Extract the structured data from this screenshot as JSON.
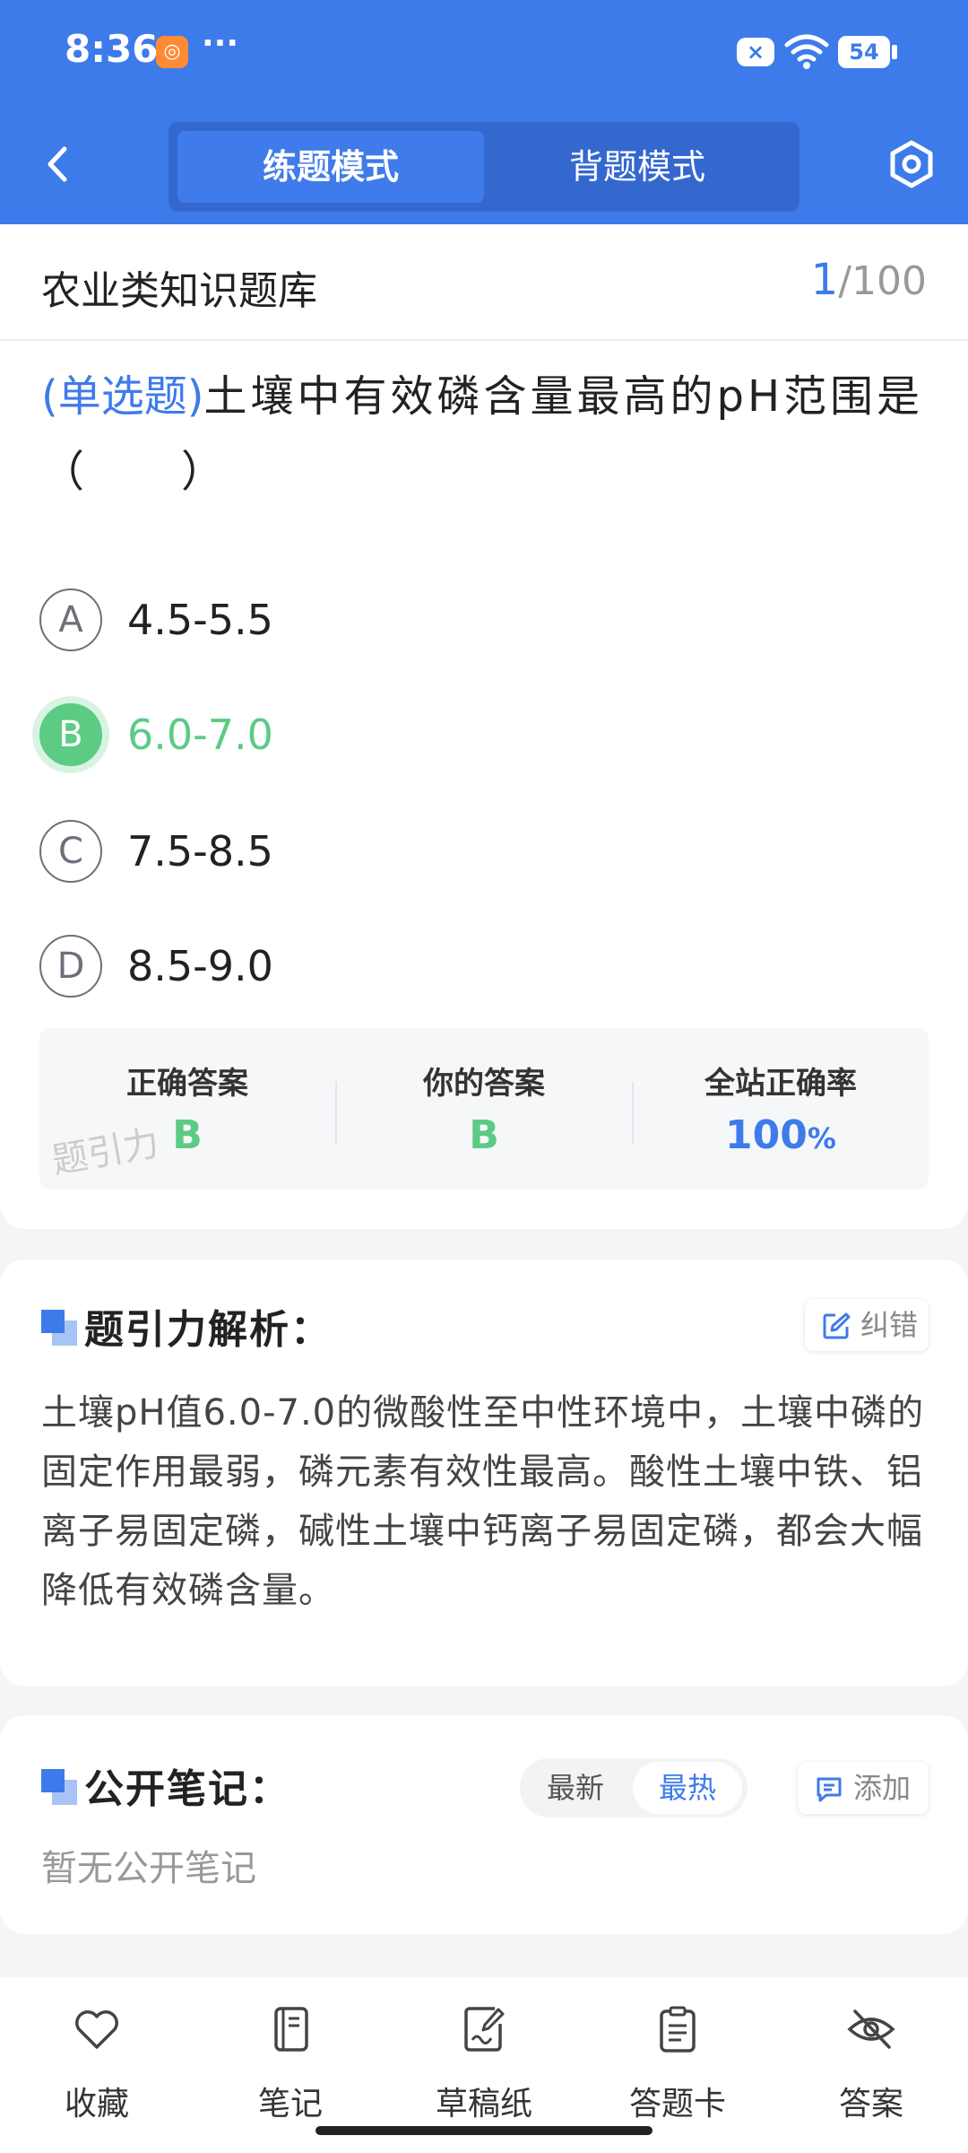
{
  "status_bar": {
    "time": "8:36",
    "app_icon_glyph": "◎",
    "more": "···",
    "notification": "×",
    "battery": "54"
  },
  "header": {
    "modes": [
      {
        "label": "练题模式",
        "active": true
      },
      {
        "label": "背题模式",
        "active": false
      }
    ]
  },
  "question_card": {
    "bank_title": "农业类知识题库",
    "current_index": "1",
    "total": "/100",
    "question_type": "(单选题)",
    "question_text": "土壤中有效磷含量最高的pH范围是（　　）",
    "options": [
      {
        "letter": "A",
        "text": "4.5-5.5"
      },
      {
        "letter": "B",
        "text": "6.0-7.0"
      },
      {
        "letter": "C",
        "text": "7.5-8.5"
      },
      {
        "letter": "D",
        "text": "8.5-9.0"
      }
    ],
    "answer_summary": {
      "correct_label": "正确答案",
      "correct_value": "B",
      "yours_label": "你的答案",
      "yours_value": "B",
      "rate_label": "全站正确率",
      "rate_value": "100",
      "rate_unit": "%"
    },
    "watermark": "题引力"
  },
  "analysis": {
    "title": "题引力解析：",
    "report_button": "纠错",
    "text": "土壤pH值6.0-7.0的微酸性至中性环境中，土壤中磷的固定作用最弱，磷元素有效性最高。酸性土壤中铁、铝离子易固定磷，碱性土壤中钙离子易固定磷，都会大幅降低有效磷含量。"
  },
  "notes": {
    "title": "公开笔记：",
    "sort_latest": "最新",
    "sort_hot": "最热",
    "add_button": "添加",
    "empty_text": "暂无公开笔记"
  },
  "toolbar": {
    "items": [
      {
        "label": "收藏",
        "icon": "heart-icon"
      },
      {
        "label": "笔记",
        "icon": "notebook-icon"
      },
      {
        "label": "草稿纸",
        "icon": "draft-paper-icon"
      },
      {
        "label": "答题卡",
        "icon": "answer-card-icon"
      },
      {
        "label": "答案",
        "icon": "eye-off-icon"
      }
    ]
  },
  "colors": {
    "primary": "#3e7bea",
    "correct": "#5ccb84",
    "background": "#f4f5f7"
  }
}
